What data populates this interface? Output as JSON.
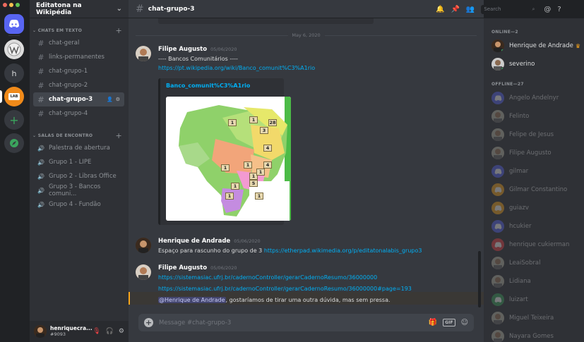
{
  "guild": {
    "name": "Editatona na Wikipédia"
  },
  "servers": [
    {
      "name": "discord-home-icon"
    },
    {
      "name": "wikipedia-icon"
    },
    {
      "label": "h"
    },
    {
      "label": "LAB"
    }
  ],
  "sidebar": {
    "text_category": "CHATS EM TEXTO",
    "voice_category": "SALAS DE ENCONTRO",
    "text_channels": [
      {
        "label": "chat-geral"
      },
      {
        "label": "links-permanentes"
      },
      {
        "label": "chat-grupo-1"
      },
      {
        "label": "chat-grupo-2"
      },
      {
        "label": "chat-grupo-3",
        "active": true
      },
      {
        "label": "chat-grupo-4"
      }
    ],
    "voice_channels": [
      {
        "label": "Palestra de abertura"
      },
      {
        "label": "Grupo 1 - LIPE"
      },
      {
        "label": "Grupo 2 - Libras Office"
      },
      {
        "label": "Grupo 3 - Bancos comuni..."
      },
      {
        "label": "Grupo 4 - Fundão"
      }
    ]
  },
  "user_panel": {
    "name": "henriquecra...",
    "tag": "#9093"
  },
  "channel": {
    "name": "chat-grupo-3",
    "composer_placeholder": "Message #chat-grupo-3"
  },
  "toolbar": {
    "search_placeholder": "Search"
  },
  "date_divider": "May 6, 2020",
  "messages": [
    {
      "author": "Filipe Augusto",
      "time": "05/06/2020",
      "lines": [
        "---- Bancos Comunitários ----",
        "https://pt.wikipedia.org/wiki/Banco_comunit%C3%A1rio"
      ],
      "embed_title": "Banco_comunit%C3%A1rio"
    },
    {
      "author": "Henrique de Andrade",
      "time": "05/06/2020",
      "text": "Espaço para rascunho do grupo de 3 ",
      "link": "https://etherpad.wikimedia.org/p/editatonalabis_grupo3"
    },
    {
      "author": "Filipe Augusto",
      "time": "05/06/2020",
      "lines": [
        "https://sistemasiac.ufrj.br/cadernoController/gerarCadernoResumo/36000000",
        "https://sistemasiac.ufrj.br/cadernoController/gerarCadernoResumo/36000000#page=193"
      ],
      "mention": "@Henrique de Andrade",
      "mention_rest": ", gostaríamos de tirar uma outra dúvida, mas sem pressa."
    }
  ],
  "map_labels": [
    "1",
    "1",
    "3",
    "28",
    "4",
    "1",
    "4",
    "1",
    "1",
    "1",
    "1",
    "5",
    "1",
    "1"
  ],
  "members": {
    "online_header": "ONLINE—2",
    "online": [
      {
        "name": "Henrique de Andrade",
        "crown": "♛"
      },
      {
        "name": "severino"
      }
    ],
    "offline_header": "OFFLINE—27",
    "offline": [
      {
        "name": "Angelo Andelnyr"
      },
      {
        "name": "Felinto"
      },
      {
        "name": "Felipe de Jesus"
      },
      {
        "name": "Filipe Augusto"
      },
      {
        "name": "gilmar"
      },
      {
        "name": "Gilmar Constantino"
      },
      {
        "name": "guiazv"
      },
      {
        "name": "hcukier"
      },
      {
        "name": "henrique cukierman"
      },
      {
        "name": "LeaiSobral"
      },
      {
        "name": "Lidiana"
      },
      {
        "name": "luizart"
      },
      {
        "name": "Miguel Teixeira"
      },
      {
        "name": "Nayara Gomes"
      }
    ]
  },
  "colors": {
    "accent": "#5865f2",
    "link": "#00aff4",
    "online": "#3ba55d",
    "mention_bar": "#faa61a"
  }
}
